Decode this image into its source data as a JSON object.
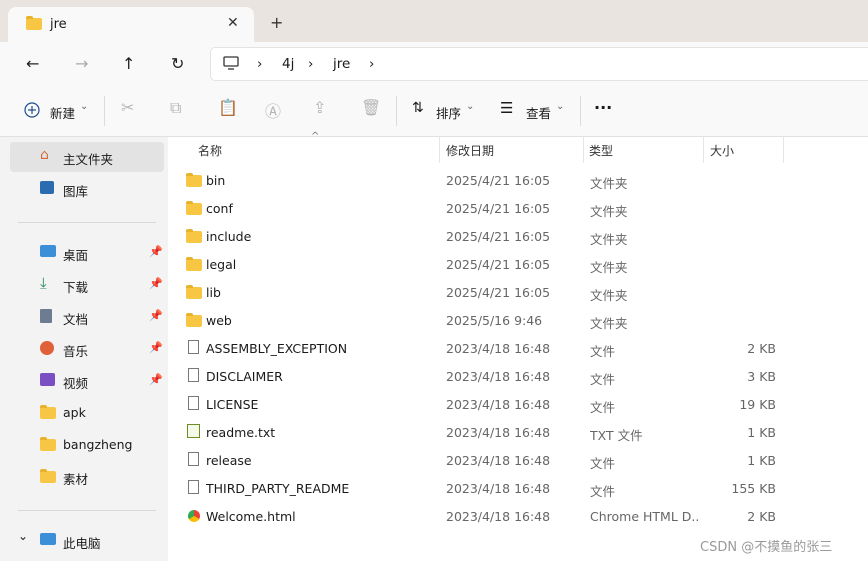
{
  "window": {
    "tab_title": "jre",
    "tab_close": "✕",
    "new_tab": "+"
  },
  "navigation": {
    "back": "←",
    "forward": "→",
    "up": "↑",
    "refresh": "↻",
    "breadcrumbs": [
      "4j",
      "jre"
    ],
    "chevron": "›"
  },
  "toolbar": {
    "new_label": "新建",
    "sort_label": "排序",
    "view_label": "查看",
    "more_label": "···"
  },
  "sidebar": {
    "items": [
      {
        "label": "主文件夹",
        "icon": "home-icon",
        "pinned": false
      },
      {
        "label": "图库",
        "icon": "gallery-icon",
        "pinned": false
      },
      {
        "label": "桌面",
        "icon": "desktop-icon",
        "pinned": true
      },
      {
        "label": "下载",
        "icon": "download-icon",
        "pinned": true
      },
      {
        "label": "文档",
        "icon": "document-icon",
        "pinned": true
      },
      {
        "label": "音乐",
        "icon": "music-icon",
        "pinned": true
      },
      {
        "label": "视频",
        "icon": "video-icon",
        "pinned": true
      },
      {
        "label": "apk",
        "icon": "folder-icon",
        "pinned": false
      },
      {
        "label": "bangzheng",
        "icon": "folder-icon",
        "pinned": false
      },
      {
        "label": "素材",
        "icon": "folder-icon",
        "pinned": false
      },
      {
        "label": "此电脑",
        "icon": "pc-icon",
        "pinned": false
      }
    ],
    "pin_glyph": "📌",
    "expand_glyph": "⌄"
  },
  "columns": {
    "name": "名称",
    "date": "修改日期",
    "type": "类型",
    "size": "大小"
  },
  "files": [
    {
      "name": "bin",
      "date": "2025/4/21 16:05",
      "type": "文件夹",
      "size": "",
      "kind": "folder"
    },
    {
      "name": "conf",
      "date": "2025/4/21 16:05",
      "type": "文件夹",
      "size": "",
      "kind": "folder"
    },
    {
      "name": "include",
      "date": "2025/4/21 16:05",
      "type": "文件夹",
      "size": "",
      "kind": "folder"
    },
    {
      "name": "legal",
      "date": "2025/4/21 16:05",
      "type": "文件夹",
      "size": "",
      "kind": "folder"
    },
    {
      "name": "lib",
      "date": "2025/4/21 16:05",
      "type": "文件夹",
      "size": "",
      "kind": "folder"
    },
    {
      "name": "web",
      "date": "2025/5/16 9:46",
      "type": "文件夹",
      "size": "",
      "kind": "folder"
    },
    {
      "name": "ASSEMBLY_EXCEPTION",
      "date": "2023/4/18 16:48",
      "type": "文件",
      "size": "2 KB",
      "kind": "file"
    },
    {
      "name": "DISCLAIMER",
      "date": "2023/4/18 16:48",
      "type": "文件",
      "size": "3 KB",
      "kind": "file"
    },
    {
      "name": "LICENSE",
      "date": "2023/4/18 16:48",
      "type": "文件",
      "size": "19 KB",
      "kind": "file"
    },
    {
      "name": "readme.txt",
      "date": "2023/4/18 16:48",
      "type": "TXT 文件",
      "size": "1 KB",
      "kind": "txt"
    },
    {
      "name": "release",
      "date": "2023/4/18 16:48",
      "type": "文件",
      "size": "1 KB",
      "kind": "file"
    },
    {
      "name": "THIRD_PARTY_README",
      "date": "2023/4/18 16:48",
      "type": "文件",
      "size": "155 KB",
      "kind": "file"
    },
    {
      "name": "Welcome.html",
      "date": "2023/4/18 16:48",
      "type": "Chrome HTML D...",
      "size": "2 KB",
      "kind": "html"
    }
  ],
  "watermark": "CSDN @不摸鱼的张三"
}
